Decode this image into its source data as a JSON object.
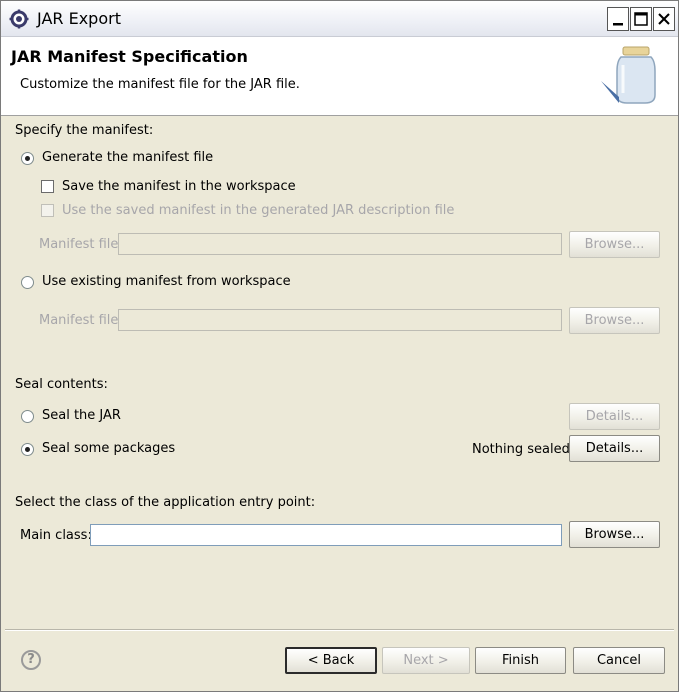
{
  "window": {
    "title": "JAR Export"
  },
  "header": {
    "title": "JAR Manifest Specification",
    "description": "Customize the manifest file for the JAR file."
  },
  "manifest": {
    "section_label": "Specify the manifest:",
    "generate_option": {
      "label": "Generate the manifest file",
      "selected": true
    },
    "save_in_workspace": {
      "label": "Save the manifest in the workspace",
      "checked": false
    },
    "reuse_saved": {
      "label": "Use the saved manifest in the generated JAR description file",
      "checked": false,
      "enabled": false
    },
    "manifest_file_label_1": "Manifest file:",
    "manifest_file_value_1": "",
    "browse_label_1": "Browse...",
    "use_existing_option": {
      "label": "Use existing manifest from workspace",
      "selected": false
    },
    "manifest_file_label_2": "Manifest file:",
    "manifest_file_value_2": "",
    "browse_label_2": "Browse..."
  },
  "seal": {
    "section_label": "Seal contents:",
    "seal_jar": {
      "label": "Seal the JAR",
      "selected": false,
      "details_label": "Details..."
    },
    "seal_some": {
      "label": "Seal some packages",
      "selected": true,
      "status": "Nothing sealed",
      "details_label": "Details..."
    }
  },
  "entry_point": {
    "section_label": "Select the class of the application entry point:",
    "main_class_label": "Main class:",
    "main_class_value": "",
    "browse_label": "Browse..."
  },
  "footer": {
    "help_icon": "question-circle-icon",
    "help_glyph": "?",
    "back_label": "< Back",
    "next_label": "Next >",
    "finish_label": "Finish",
    "cancel_label": "Cancel"
  }
}
